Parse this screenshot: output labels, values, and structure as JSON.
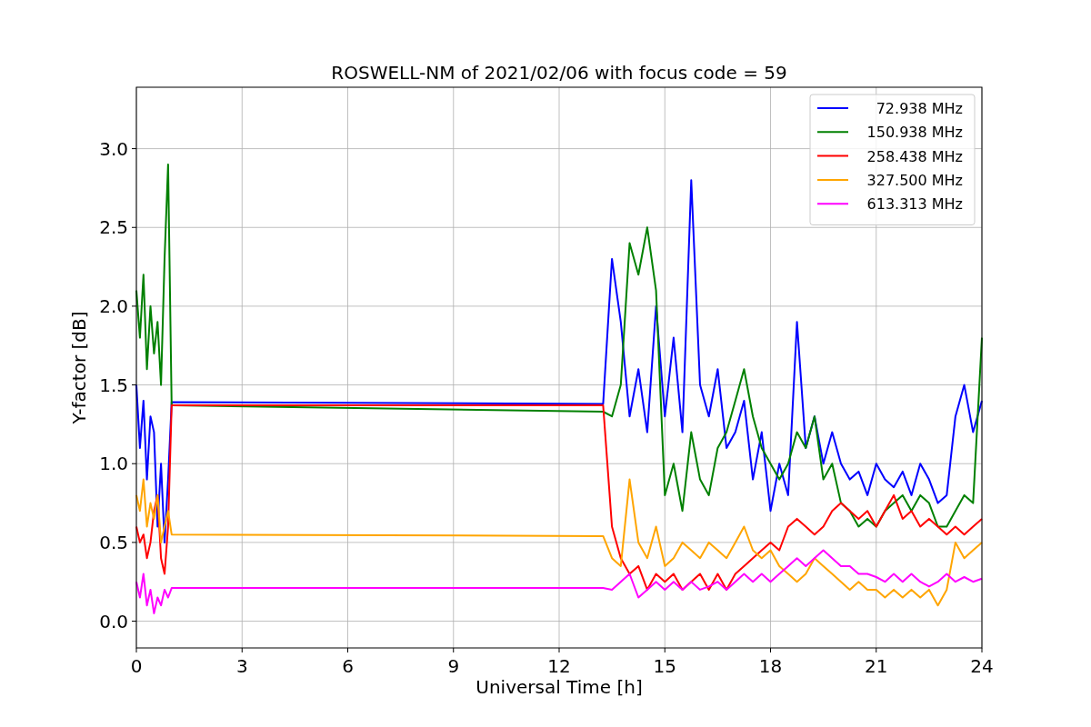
{
  "figure": {
    "chart_data": {
      "type": "line",
      "title": "ROSWELL-NM of 2021/02/06 with focus code = 59",
      "xlabel": "Universal Time [h]",
      "ylabel": "Y-factor [dB]",
      "x": [
        0,
        0.1,
        0.2,
        0.3,
        0.4,
        0.5,
        0.6,
        0.7,
        0.8,
        0.9,
        1.0,
        13.25,
        13.5,
        13.75,
        14,
        14.25,
        14.5,
        14.75,
        15,
        15.25,
        15.5,
        15.75,
        16,
        16.25,
        16.5,
        16.75,
        17,
        17.25,
        17.5,
        17.75,
        18,
        18.25,
        18.5,
        18.75,
        19,
        19.25,
        19.5,
        19.75,
        20,
        20.25,
        20.5,
        20.75,
        21,
        21.25,
        21.5,
        21.75,
        22,
        22.25,
        22.5,
        22.75,
        23,
        23.25,
        23.5,
        23.75,
        24
      ],
      "series": [
        {
          "name": "72.938 MHz",
          "color": "#0000ff",
          "values": [
            1.5,
            1.1,
            1.4,
            0.9,
            1.3,
            1.2,
            0.6,
            1.0,
            0.5,
            0.9,
            1.39,
            1.38,
            2.3,
            1.9,
            1.3,
            1.6,
            1.2,
            2.0,
            1.3,
            1.8,
            1.2,
            2.8,
            1.5,
            1.3,
            1.6,
            1.1,
            1.2,
            1.4,
            0.9,
            1.2,
            0.7,
            1.0,
            0.8,
            1.9,
            1.1,
            1.3,
            1.0,
            1.2,
            1.0,
            0.9,
            0.95,
            0.8,
            1.0,
            0.9,
            0.85,
            0.95,
            0.8,
            1.0,
            0.9,
            0.75,
            0.8,
            1.3,
            1.5,
            1.2,
            1.4
          ]
        },
        {
          "name": "150.938 MHz",
          "color": "#008000",
          "values": [
            2.1,
            1.8,
            2.2,
            1.6,
            2.0,
            1.7,
            1.9,
            1.5,
            2.3,
            2.9,
            1.37,
            1.33,
            1.3,
            1.5,
            2.4,
            2.2,
            2.5,
            2.1,
            0.8,
            1.0,
            0.7,
            1.2,
            0.9,
            0.8,
            1.1,
            1.2,
            1.4,
            1.6,
            1.3,
            1.1,
            1.0,
            0.9,
            1.0,
            1.2,
            1.1,
            1.3,
            0.9,
            1.0,
            0.75,
            0.7,
            0.6,
            0.65,
            0.6,
            0.7,
            0.75,
            0.8,
            0.7,
            0.8,
            0.75,
            0.6,
            0.6,
            0.7,
            0.8,
            0.75,
            1.8
          ]
        },
        {
          "name": "258.438 MHz",
          "color": "#ff0000",
          "values": [
            0.6,
            0.5,
            0.55,
            0.4,
            0.5,
            0.7,
            0.8,
            0.4,
            0.3,
            0.6,
            1.37,
            1.37,
            0.6,
            0.4,
            0.3,
            0.35,
            0.2,
            0.3,
            0.25,
            0.3,
            0.2,
            0.25,
            0.3,
            0.2,
            0.3,
            0.2,
            0.3,
            0.35,
            0.4,
            0.45,
            0.5,
            0.45,
            0.6,
            0.65,
            0.6,
            0.55,
            0.6,
            0.7,
            0.75,
            0.7,
            0.65,
            0.7,
            0.6,
            0.7,
            0.8,
            0.65,
            0.7,
            0.6,
            0.65,
            0.6,
            0.55,
            0.6,
            0.55,
            0.6,
            0.65
          ]
        },
        {
          "name": "327.500 MHz",
          "color": "#ffa500",
          "values": [
            0.8,
            0.7,
            0.9,
            0.6,
            0.75,
            0.65,
            0.8,
            0.5,
            0.6,
            0.7,
            0.55,
            0.54,
            0.4,
            0.35,
            0.9,
            0.5,
            0.4,
            0.6,
            0.35,
            0.4,
            0.5,
            0.45,
            0.4,
            0.5,
            0.45,
            0.4,
            0.5,
            0.6,
            0.45,
            0.4,
            0.45,
            0.35,
            0.3,
            0.25,
            0.3,
            0.4,
            0.35,
            0.3,
            0.25,
            0.2,
            0.25,
            0.2,
            0.2,
            0.15,
            0.2,
            0.15,
            0.2,
            0.15,
            0.2,
            0.1,
            0.2,
            0.5,
            0.4,
            0.45,
            0.5
          ]
        },
        {
          "name": "613.313 MHz",
          "color": "#ff00ff",
          "values": [
            0.25,
            0.15,
            0.3,
            0.1,
            0.2,
            0.05,
            0.15,
            0.1,
            0.2,
            0.15,
            0.21,
            0.21,
            0.2,
            0.25,
            0.3,
            0.15,
            0.2,
            0.25,
            0.2,
            0.25,
            0.2,
            0.25,
            0.2,
            0.22,
            0.25,
            0.2,
            0.25,
            0.3,
            0.25,
            0.3,
            0.25,
            0.3,
            0.35,
            0.4,
            0.35,
            0.4,
            0.45,
            0.4,
            0.35,
            0.35,
            0.3,
            0.3,
            0.28,
            0.25,
            0.3,
            0.25,
            0.3,
            0.25,
            0.22,
            0.25,
            0.3,
            0.25,
            0.28,
            0.25,
            0.27
          ]
        }
      ],
      "grid": true,
      "legend": "upper right",
      "xlim": [
        0,
        24
      ],
      "ylim": [
        -0.17,
        3.39
      ],
      "xticks": [
        0,
        3,
        6,
        9,
        12,
        15,
        18,
        21,
        24
      ],
      "yticks": [
        {
          "value": 0,
          "label": "0.0"
        },
        {
          "value": 0.5,
          "label": "0.5"
        },
        {
          "value": 1,
          "label": "1.0"
        },
        {
          "value": 1.5,
          "label": "1.5"
        },
        {
          "value": 2,
          "label": "2.0"
        },
        {
          "value": 2.5,
          "label": "2.5"
        },
        {
          "value": 3,
          "label": "3.0"
        }
      ]
    }
  }
}
